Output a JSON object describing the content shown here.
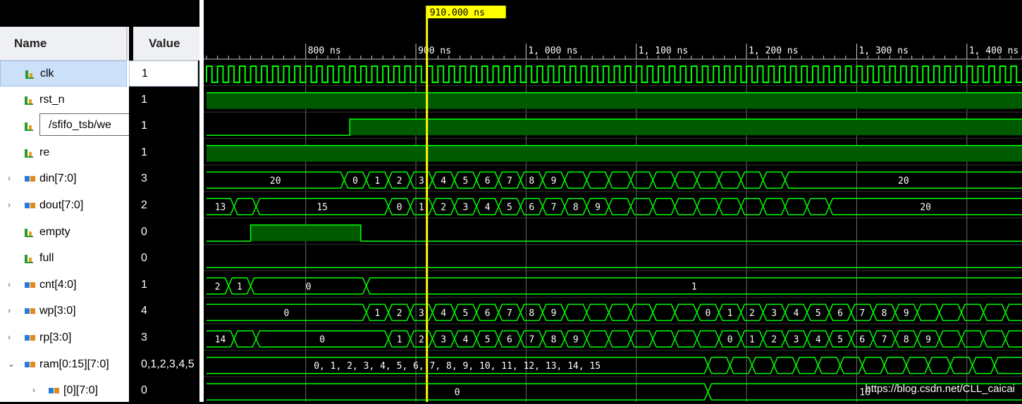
{
  "columns": {
    "name": "Name",
    "value": "Value"
  },
  "cursor": {
    "label": "910.000 ns"
  },
  "timeline": {
    "t_start_ns": 710,
    "t_end_ns": 1450,
    "ticks": [
      {
        "t": 800,
        "label": "800 ns"
      },
      {
        "t": 900,
        "label": "900 ns"
      },
      {
        "t": 1000,
        "label": "1, 000 ns"
      },
      {
        "t": 1100,
        "label": "1, 100 ns"
      },
      {
        "t": 1200,
        "label": "1, 200 ns"
      },
      {
        "t": 1300,
        "label": "1, 300 ns"
      },
      {
        "t": 1400,
        "label": "1, 400 ns"
      }
    ]
  },
  "signals": [
    {
      "id": "clk",
      "label": "clk",
      "value": "1",
      "kind": "bit",
      "expand": "",
      "selected": true
    },
    {
      "id": "rst_n",
      "label": "rst_n",
      "value": "1",
      "kind": "bit",
      "expand": ""
    },
    {
      "id": "we",
      "label": "/sfifo_tsb/we",
      "value": "1",
      "kind": "bit",
      "expand": "",
      "tooltip": true
    },
    {
      "id": "re",
      "label": "re",
      "value": "1",
      "kind": "bit",
      "expand": ""
    },
    {
      "id": "din",
      "label": "din[7:0]",
      "value": "3",
      "kind": "bus",
      "expand": "›"
    },
    {
      "id": "dout",
      "label": "dout[7:0]",
      "value": "2",
      "kind": "bus",
      "expand": "›"
    },
    {
      "id": "empty",
      "label": "empty",
      "value": "0",
      "kind": "bit",
      "expand": ""
    },
    {
      "id": "full",
      "label": "full",
      "value": "0",
      "kind": "bit",
      "expand": ""
    },
    {
      "id": "cnt",
      "label": "cnt[4:0]",
      "value": "1",
      "kind": "bus",
      "expand": "›"
    },
    {
      "id": "wp",
      "label": "wp[3:0]",
      "value": "4",
      "kind": "bus",
      "expand": "›"
    },
    {
      "id": "rp",
      "label": "rp[3:0]",
      "value": "3",
      "kind": "bus",
      "expand": "›"
    },
    {
      "id": "ram",
      "label": "ram[0:15][7:0]",
      "value": "0,1,2,3,4,5",
      "kind": "bus",
      "expand": "⌄"
    },
    {
      "id": "ram0",
      "label": "[0][7:0]",
      "value": "0",
      "kind": "bus",
      "expand": "›",
      "indent": true
    }
  ],
  "waves": {
    "rst_n": "high",
    "we": [
      {
        "t": 710,
        "v": 0
      },
      {
        "t": 840,
        "v": 1
      }
    ],
    "re": "high",
    "empty": [
      {
        "t": 710,
        "v": 0
      },
      {
        "t": 750,
        "v": 1
      },
      {
        "t": 850,
        "v": 0
      }
    ],
    "full": "low",
    "din": {
      "segments": [
        {
          "t0": 710,
          "t1": 835,
          "label": "20"
        },
        {
          "t0": 835,
          "t1": 855,
          "label": "0"
        },
        {
          "t0": 855,
          "t1": 875,
          "label": "1"
        },
        {
          "t0": 875,
          "t1": 895,
          "label": "2"
        },
        {
          "t0": 895,
          "t1": 915,
          "label": "3"
        },
        {
          "t0": 915,
          "t1": 935,
          "label": "4"
        },
        {
          "t0": 935,
          "t1": 955,
          "label": "5"
        },
        {
          "t0": 955,
          "t1": 975,
          "label": "6"
        },
        {
          "t0": 975,
          "t1": 995,
          "label": "7"
        },
        {
          "t0": 995,
          "t1": 1015,
          "label": "8"
        },
        {
          "t0": 1015,
          "t1": 1035,
          "label": "9"
        },
        {
          "t0": 1035,
          "t1": 1055,
          "label": ""
        },
        {
          "t0": 1055,
          "t1": 1075,
          "label": ""
        },
        {
          "t0": 1075,
          "t1": 1095,
          "label": ""
        },
        {
          "t0": 1095,
          "t1": 1115,
          "label": ""
        },
        {
          "t0": 1115,
          "t1": 1135,
          "label": ""
        },
        {
          "t0": 1135,
          "t1": 1155,
          "label": ""
        },
        {
          "t0": 1155,
          "t1": 1175,
          "label": ""
        },
        {
          "t0": 1175,
          "t1": 1195,
          "label": ""
        },
        {
          "t0": 1195,
          "t1": 1215,
          "label": ""
        },
        {
          "t0": 1215,
          "t1": 1235,
          "label": ""
        },
        {
          "t0": 1235,
          "t1": 1450,
          "label": "20"
        }
      ]
    },
    "dout": {
      "segments": [
        {
          "t0": 710,
          "t1": 735,
          "label": "13"
        },
        {
          "t0": 735,
          "t1": 755,
          "label": ""
        },
        {
          "t0": 755,
          "t1": 875,
          "label": "15"
        },
        {
          "t0": 875,
          "t1": 895,
          "label": "0"
        },
        {
          "t0": 895,
          "t1": 915,
          "label": "1"
        },
        {
          "t0": 915,
          "t1": 935,
          "label": "2"
        },
        {
          "t0": 935,
          "t1": 955,
          "label": "3"
        },
        {
          "t0": 955,
          "t1": 975,
          "label": "4"
        },
        {
          "t0": 975,
          "t1": 995,
          "label": "5"
        },
        {
          "t0": 995,
          "t1": 1015,
          "label": "6"
        },
        {
          "t0": 1015,
          "t1": 1035,
          "label": "7"
        },
        {
          "t0": 1035,
          "t1": 1055,
          "label": "8"
        },
        {
          "t0": 1055,
          "t1": 1075,
          "label": "9"
        },
        {
          "t0": 1075,
          "t1": 1095,
          "label": ""
        },
        {
          "t0": 1095,
          "t1": 1115,
          "label": ""
        },
        {
          "t0": 1115,
          "t1": 1135,
          "label": ""
        },
        {
          "t0": 1135,
          "t1": 1155,
          "label": ""
        },
        {
          "t0": 1155,
          "t1": 1175,
          "label": ""
        },
        {
          "t0": 1175,
          "t1": 1195,
          "label": ""
        },
        {
          "t0": 1195,
          "t1": 1215,
          "label": ""
        },
        {
          "t0": 1215,
          "t1": 1235,
          "label": ""
        },
        {
          "t0": 1235,
          "t1": 1255,
          "label": ""
        },
        {
          "t0": 1255,
          "t1": 1275,
          "label": ""
        },
        {
          "t0": 1275,
          "t1": 1450,
          "label": "20"
        }
      ]
    },
    "cnt": {
      "segments": [
        {
          "t0": 710,
          "t1": 730,
          "label": "2"
        },
        {
          "t0": 730,
          "t1": 750,
          "label": "1"
        },
        {
          "t0": 750,
          "t1": 855,
          "label": "0"
        },
        {
          "t0": 855,
          "t1": 1450,
          "label": "1"
        }
      ]
    },
    "wp": {
      "segments": [
        {
          "t0": 710,
          "t1": 855,
          "label": "0"
        },
        {
          "t0": 855,
          "t1": 875,
          "label": "1"
        },
        {
          "t0": 875,
          "t1": 895,
          "label": "2"
        },
        {
          "t0": 895,
          "t1": 915,
          "label": "3"
        },
        {
          "t0": 915,
          "t1": 935,
          "label": "4"
        },
        {
          "t0": 935,
          "t1": 955,
          "label": "5"
        },
        {
          "t0": 955,
          "t1": 975,
          "label": "6"
        },
        {
          "t0": 975,
          "t1": 995,
          "label": "7"
        },
        {
          "t0": 995,
          "t1": 1015,
          "label": "8"
        },
        {
          "t0": 1015,
          "t1": 1035,
          "label": "9"
        },
        {
          "t0": 1035,
          "t1": 1055,
          "label": ""
        },
        {
          "t0": 1055,
          "t1": 1075,
          "label": ""
        },
        {
          "t0": 1075,
          "t1": 1095,
          "label": ""
        },
        {
          "t0": 1095,
          "t1": 1115,
          "label": ""
        },
        {
          "t0": 1115,
          "t1": 1135,
          "label": ""
        },
        {
          "t0": 1135,
          "t1": 1155,
          "label": ""
        },
        {
          "t0": 1155,
          "t1": 1175,
          "label": "0"
        },
        {
          "t0": 1175,
          "t1": 1195,
          "label": "1"
        },
        {
          "t0": 1195,
          "t1": 1215,
          "label": "2"
        },
        {
          "t0": 1215,
          "t1": 1235,
          "label": "3"
        },
        {
          "t0": 1235,
          "t1": 1255,
          "label": "4"
        },
        {
          "t0": 1255,
          "t1": 1275,
          "label": "5"
        },
        {
          "t0": 1275,
          "t1": 1295,
          "label": "6"
        },
        {
          "t0": 1295,
          "t1": 1315,
          "label": "7"
        },
        {
          "t0": 1315,
          "t1": 1335,
          "label": "8"
        },
        {
          "t0": 1335,
          "t1": 1355,
          "label": "9"
        },
        {
          "t0": 1355,
          "t1": 1375,
          "label": ""
        },
        {
          "t0": 1375,
          "t1": 1395,
          "label": ""
        },
        {
          "t0": 1395,
          "t1": 1415,
          "label": ""
        },
        {
          "t0": 1415,
          "t1": 1435,
          "label": ""
        },
        {
          "t0": 1435,
          "t1": 1450,
          "label": ""
        }
      ]
    },
    "rp": {
      "segments": [
        {
          "t0": 710,
          "t1": 735,
          "label": "14"
        },
        {
          "t0": 735,
          "t1": 755,
          "label": ""
        },
        {
          "t0": 755,
          "t1": 875,
          "label": "0"
        },
        {
          "t0": 875,
          "t1": 895,
          "label": "1"
        },
        {
          "t0": 895,
          "t1": 915,
          "label": "2"
        },
        {
          "t0": 915,
          "t1": 935,
          "label": "3"
        },
        {
          "t0": 935,
          "t1": 955,
          "label": "4"
        },
        {
          "t0": 955,
          "t1": 975,
          "label": "5"
        },
        {
          "t0": 975,
          "t1": 995,
          "label": "6"
        },
        {
          "t0": 995,
          "t1": 1015,
          "label": "7"
        },
        {
          "t0": 1015,
          "t1": 1035,
          "label": "8"
        },
        {
          "t0": 1035,
          "t1": 1055,
          "label": "9"
        },
        {
          "t0": 1055,
          "t1": 1075,
          "label": ""
        },
        {
          "t0": 1075,
          "t1": 1095,
          "label": ""
        },
        {
          "t0": 1095,
          "t1": 1115,
          "label": ""
        },
        {
          "t0": 1115,
          "t1": 1135,
          "label": ""
        },
        {
          "t0": 1135,
          "t1": 1155,
          "label": ""
        },
        {
          "t0": 1155,
          "t1": 1175,
          "label": ""
        },
        {
          "t0": 1175,
          "t1": 1195,
          "label": "0"
        },
        {
          "t0": 1195,
          "t1": 1215,
          "label": "1"
        },
        {
          "t0": 1215,
          "t1": 1235,
          "label": "2"
        },
        {
          "t0": 1235,
          "t1": 1255,
          "label": "3"
        },
        {
          "t0": 1255,
          "t1": 1275,
          "label": "4"
        },
        {
          "t0": 1275,
          "t1": 1295,
          "label": "5"
        },
        {
          "t0": 1295,
          "t1": 1315,
          "label": "6"
        },
        {
          "t0": 1315,
          "t1": 1335,
          "label": "7"
        },
        {
          "t0": 1335,
          "t1": 1355,
          "label": "8"
        },
        {
          "t0": 1355,
          "t1": 1375,
          "label": "9"
        },
        {
          "t0": 1375,
          "t1": 1395,
          "label": ""
        },
        {
          "t0": 1395,
          "t1": 1415,
          "label": ""
        },
        {
          "t0": 1415,
          "t1": 1435,
          "label": ""
        },
        {
          "t0": 1435,
          "t1": 1450,
          "label": ""
        }
      ]
    },
    "ram": {
      "segments": [
        {
          "t0": 710,
          "t1": 1165,
          "label": "0, 1, 2, 3, 4, 5, 6, 7, 8, 9, 10, 11, 12, 13, 14, 15"
        },
        {
          "t0": 1165,
          "t1": 1185,
          "label": ""
        },
        {
          "t0": 1185,
          "t1": 1205,
          "label": ""
        },
        {
          "t0": 1205,
          "t1": 1225,
          "label": ""
        },
        {
          "t0": 1225,
          "t1": 1245,
          "label": ""
        },
        {
          "t0": 1245,
          "t1": 1265,
          "label": ""
        },
        {
          "t0": 1265,
          "t1": 1285,
          "label": ""
        },
        {
          "t0": 1285,
          "t1": 1305,
          "label": ""
        },
        {
          "t0": 1305,
          "t1": 1325,
          "label": ""
        },
        {
          "t0": 1325,
          "t1": 1345,
          "label": ""
        },
        {
          "t0": 1345,
          "t1": 1365,
          "label": ""
        },
        {
          "t0": 1365,
          "t1": 1385,
          "label": ""
        },
        {
          "t0": 1385,
          "t1": 1405,
          "label": ""
        },
        {
          "t0": 1405,
          "t1": 1425,
          "label": ""
        },
        {
          "t0": 1425,
          "t1": 1450,
          "label": ""
        }
      ]
    },
    "ram0": {
      "segments": [
        {
          "t0": 710,
          "t1": 1165,
          "label": "0"
        },
        {
          "t0": 1165,
          "t1": 1450,
          "label": "16"
        }
      ]
    }
  },
  "colors": {
    "wave": "#00ff00",
    "fill": "#005a00",
    "cursor": "#ffff00",
    "grid": "#6b6b6b",
    "bg": "#000000"
  },
  "watermark": "https://blog.csdn.net/CLL_caicai"
}
